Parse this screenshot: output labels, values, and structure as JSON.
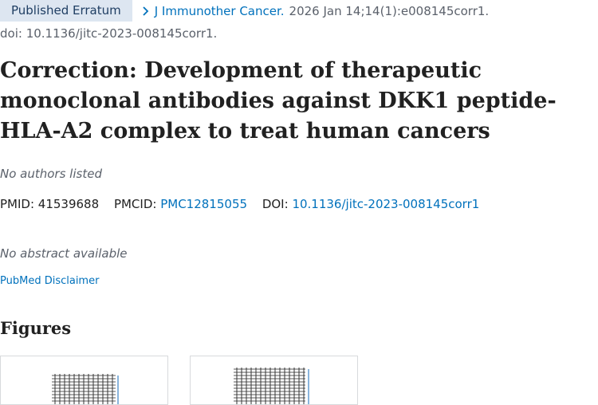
{
  "header": {
    "badge": "Published Erratum",
    "journal": "J Immunother Cancer.",
    "citation": "2026 Jan 14;14(1):e008145corr1.",
    "doi_line": "doi: 10.1136/jitc-2023-008145corr1."
  },
  "article": {
    "title": "Correction: Development of therapeutic monoclonal antibodies against DKK1 peptide-HLA-A2 complex to treat human cancers",
    "authors": "No authors listed"
  },
  "identifiers": {
    "pmid_label": "PMID:",
    "pmid": "41539688",
    "pmcid_label": "PMCID:",
    "pmcid": "PMC12815055",
    "doi_label": "DOI:",
    "doi": "10.1136/jitc-2023-008145corr1"
  },
  "abstract": "No abstract available",
  "disclaimer": "PubMed Disclaimer",
  "figures": {
    "heading": "Figures"
  },
  "colors": {
    "link": "#0071bc",
    "badge_bg": "#dde6f1",
    "text": "#212121",
    "muted": "#5b616b"
  },
  "icons": [
    "chevron-right-icon"
  ]
}
